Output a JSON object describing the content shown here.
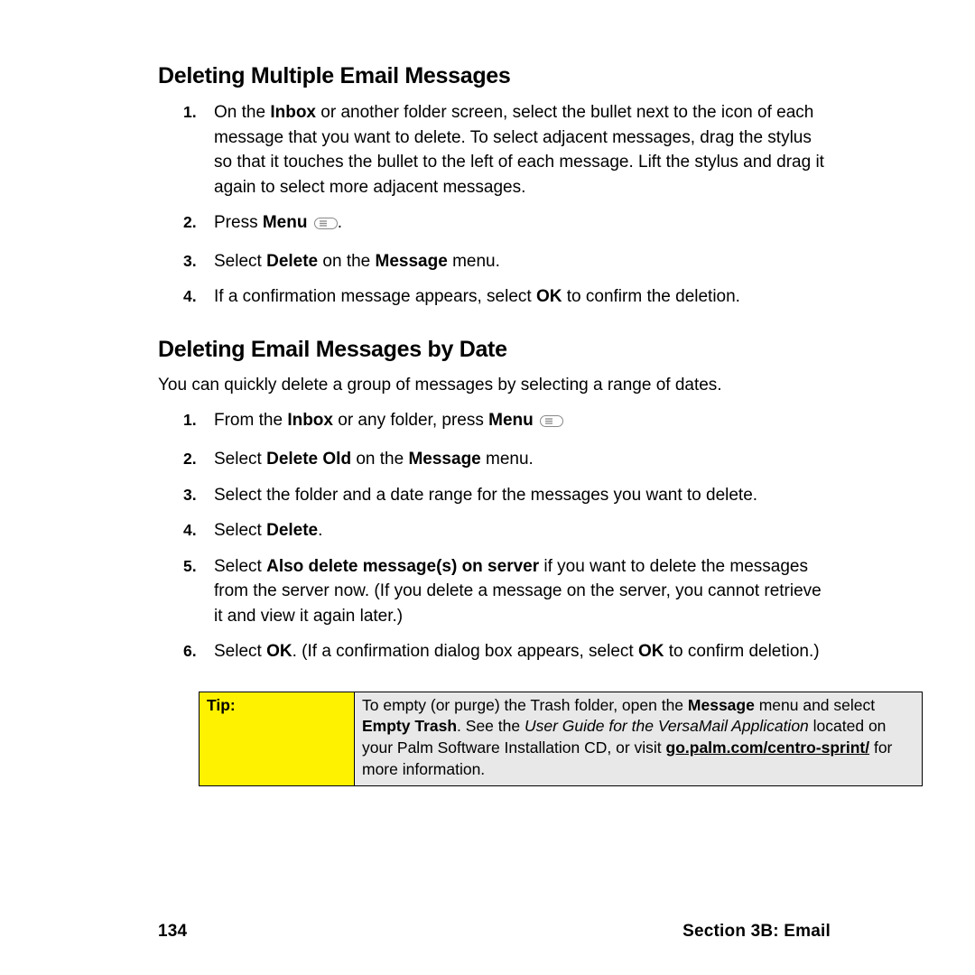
{
  "section1": {
    "heading": "Deleting Multiple Email Messages",
    "items": {
      "i1": "On the <span class=\"b\">Inbox</span> or another folder screen, select the bullet next to the icon of each message that you want to delete. To select adjacent messages, drag the stylus so that it touches the bullet to the left of each message. Lift the stylus and drag it again to select more adjacent messages.",
      "i2": "Press <span class=\"b\">Menu</span> ",
      "i3": "Select <span class=\"b\">Delete</span> on the <span class=\"b\">Message</span> menu.",
      "i4": "If a confirmation message appears, select <span class=\"b\">OK</span> to confirm the deletion."
    }
  },
  "section2": {
    "heading": "Deleting Email Messages by Date",
    "intro": "You can quickly delete a group of messages by selecting a range of dates.",
    "items": {
      "i1": "From the <span class=\"b\">Inbox</span> or any folder, press <span class=\"b\">Menu</span> ",
      "i2": "Select <span class=\"b\">Delete Old</span> on the <span class=\"b\">Message</span> menu.",
      "i3": "Select the folder and a date range for the messages you want to delete.",
      "i4": "Select <span class=\"b\">Delete</span>.",
      "i5": "Select <span class=\"b\">Also delete message(s) on server</span> if you want to delete the messages from the server now. (If you delete a message on the server, you cannot retrieve it and view it again later.)",
      "i6": "Select <span class=\"b\">OK</span>. (If a confirmation dialog box appears, select <span class=\"b\">OK</span> to confirm deletion.)"
    }
  },
  "tip": {
    "label": "Tip:",
    "body": "To empty (or purge) the Trash folder, open the <span class=\"b\">Message</span> menu and select <span class=\"b\">Empty Trash</span>. See the <span class=\"italic\">User Guide for the VersaMail Application</span> located on your Palm Software Installation CD, or visit <a class=\"link\" data-name=\"tip-link\" data-interactable=\"true\">go.palm.com/centro-sprint/</a> for more information."
  },
  "footer": {
    "page": "134",
    "section": "Section 3B: Email"
  },
  "icons": {
    "menu": "menu-icon"
  }
}
